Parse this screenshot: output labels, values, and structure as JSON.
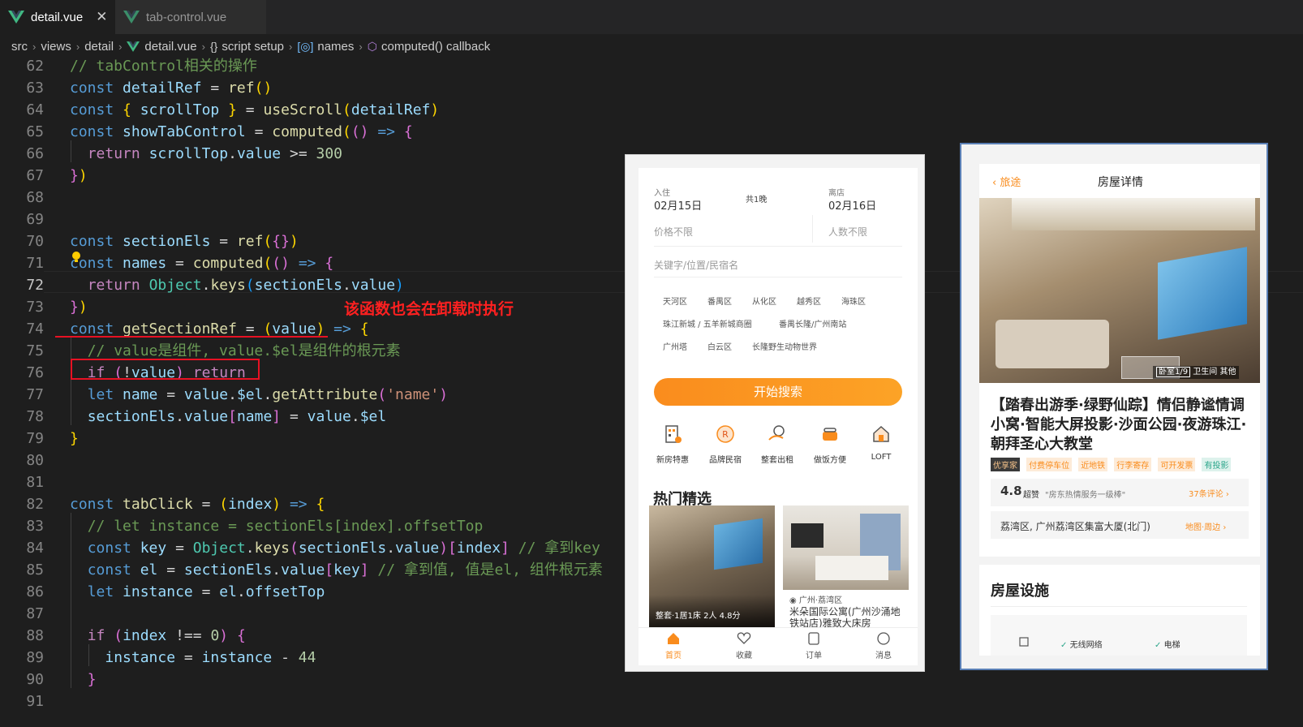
{
  "tabs": [
    {
      "label": "detail.vue",
      "close": "✕"
    },
    {
      "label": "tab-control.vue"
    }
  ],
  "breadcrumb": {
    "items": [
      "src",
      "views",
      "detail",
      "detail.vue",
      "script setup",
      "names",
      "computed() callback"
    ],
    "sep": "›"
  },
  "line_numbers": [
    "62",
    "63",
    "64",
    "65",
    "66",
    "67",
    "68",
    "69",
    "70",
    "71",
    "72",
    "73",
    "74",
    "75",
    "76",
    "77",
    "78",
    "79",
    "80",
    "81",
    "82",
    "83",
    "84",
    "85",
    "86",
    "87",
    "88",
    "89",
    "90",
    "91"
  ],
  "annotation": "该函数也会在卸载时执行",
  "phone1": {
    "checkin_label": "入住",
    "checkin_date": "02月15日",
    "nights": "共1晚",
    "checkout_label": "离店",
    "checkout_date": "02月16日",
    "price": "价格不限",
    "people": "人数不限",
    "keyword_placeholder": "关键字/位置/民宿名",
    "regions": [
      "天河区",
      "番禺区",
      "从化区",
      "越秀区",
      "海珠区",
      "珠江新城 / 五羊新城商圈",
      "番禺长隆/广州南站",
      "广州塔",
      "白云区",
      "长隆野生动物世界"
    ],
    "search_button": "开始搜索",
    "categories": [
      "新房特惠",
      "品牌民宿",
      "整套出租",
      "做饭方便",
      "LOFT"
    ],
    "hot_title": "热门精选",
    "card1_caption": "整套·1居1床 2人 4.8分",
    "card2_location": "广州·荔湾区",
    "card2_title": "米朵国际公寓(广州沙涌地铁站店)雅致大床房",
    "nav": [
      "首页",
      "收藏",
      "订单",
      "消息"
    ]
  },
  "phone2": {
    "back": "旅途",
    "title": "房屋详情",
    "photo_badge": [
      "卧室1/9",
      "卫生间",
      "其他"
    ],
    "listing_title": "【踏春出游季·绿野仙踪】情侣静谧情调小窝·智能大屏投影·沙面公园·夜游珠江·朝拜圣心大教堂",
    "tags": [
      "优享家",
      "付费停车位",
      "近地铁",
      "行李寄存",
      "可开发票",
      "有投影"
    ],
    "rating": "4.8",
    "rating_word": "超赞",
    "rating_quote": "\"房东热情服务一级棒\"",
    "reviews": "37条评论 ›",
    "address": "荔湾区, 广州荔湾区集富大厦(北门)",
    "map_link": "地图·周边 ›",
    "facilities_title": "房屋设施",
    "facilities": [
      "无线网络",
      "电梯"
    ]
  },
  "colors": {
    "accent": "#f98c1d",
    "annotation": "#ff2020",
    "box": "#e81123"
  }
}
